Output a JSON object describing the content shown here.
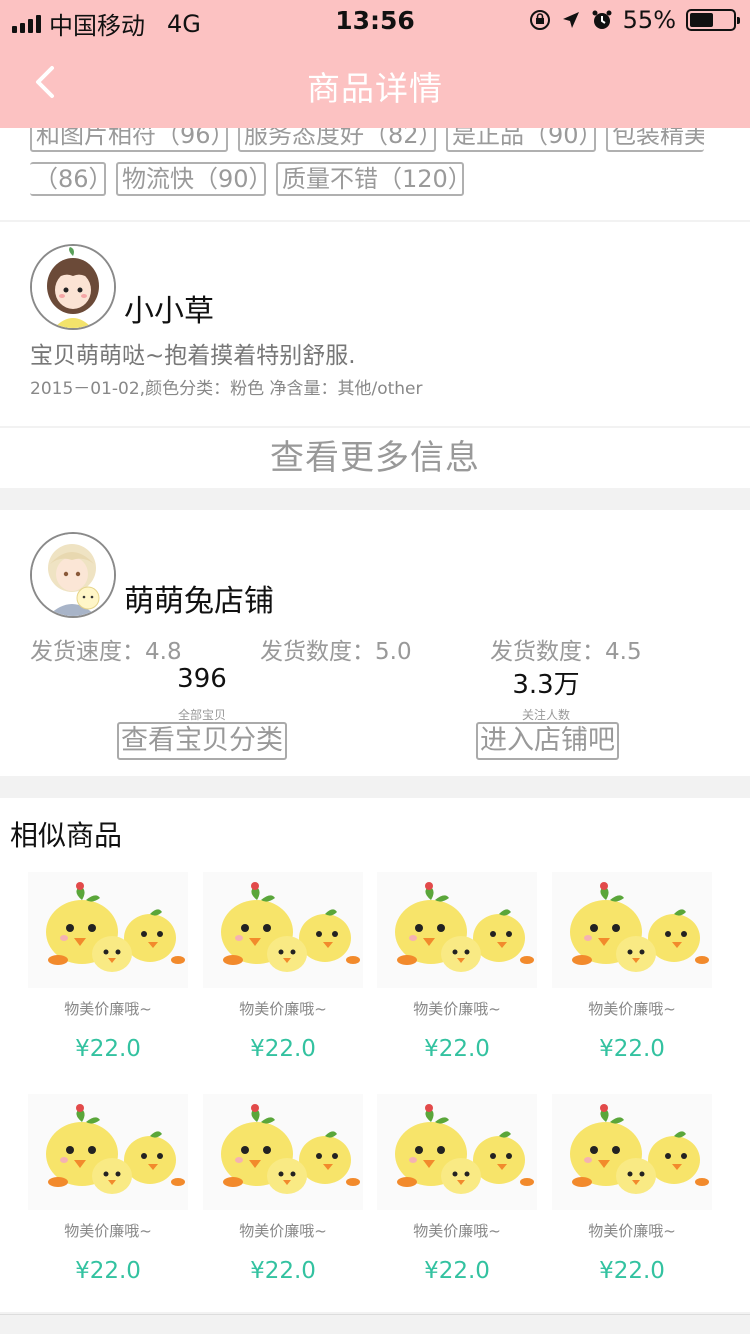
{
  "status_bar": {
    "carrier": "中国移动",
    "network": "4G",
    "time": "13:56",
    "battery": "55%",
    "battery_level": 0.55
  },
  "nav": {
    "back_icon": "chevron-left-icon",
    "title": "商品详情"
  },
  "tags": [
    "和图片相符（96）",
    "服务态度好（82）",
    "是正品（90）",
    "包装精美",
    "（86）",
    "物流快（90）",
    "质量不错（120）"
  ],
  "review": {
    "reviewer_name": "小小草",
    "text": "宝贝萌萌哒~抱着摸着特别舒服.",
    "meta": "2015－01-02,颜色分类：粉色 净含量：其他/other",
    "more_info": "查看更多信息"
  },
  "shop": {
    "name": "萌萌兔店铺",
    "stats": [
      {
        "label": "发货速度：",
        "value": "4.8"
      },
      {
        "label": "发货数度：",
        "value": "5.0"
      },
      {
        "label": "发货数度：",
        "value": "4.5"
      }
    ],
    "counts": [
      {
        "value": "396",
        "label": "全部宝贝"
      },
      {
        "value": "3.3万",
        "label": "关注人数"
      }
    ],
    "buttons": {
      "categories": "查看宝贝分类",
      "enter_shop": "进入店铺吧"
    }
  },
  "similar": {
    "title": "相似商品",
    "products": [
      {
        "desc": "物美价廉哦~",
        "price": "¥22.0"
      },
      {
        "desc": "物美价廉哦~",
        "price": "¥22.0"
      },
      {
        "desc": "物美价廉哦~",
        "price": "¥22.0"
      },
      {
        "desc": "物美价廉哦~",
        "price": "¥22.0"
      },
      {
        "desc": "物美价廉哦~",
        "price": "¥22.0"
      },
      {
        "desc": "物美价廉哦~",
        "price": "¥22.0"
      },
      {
        "desc": "物美价廉哦~",
        "price": "¥22.0"
      },
      {
        "desc": "物美价廉哦~",
        "price": "¥22.0"
      }
    ]
  },
  "colors": {
    "header_bg": "#fcc2c2",
    "price": "#33c2a0"
  }
}
